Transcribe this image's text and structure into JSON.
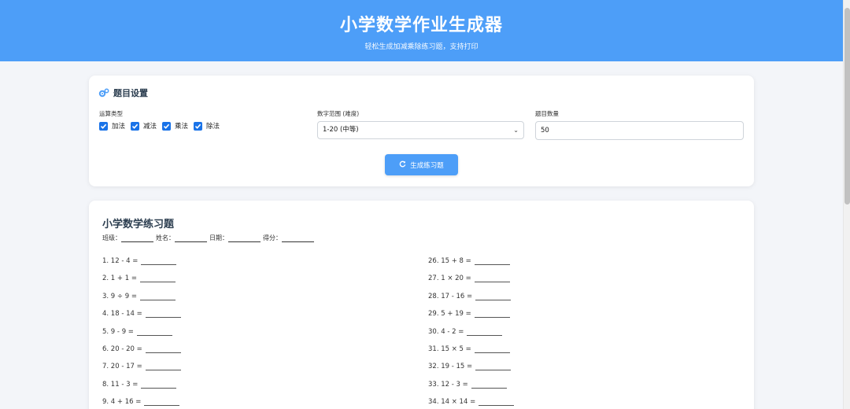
{
  "header": {
    "title": "小学数学作业生成器",
    "subtitle": "轻松生成加减乘除练习题，支持打印"
  },
  "settings": {
    "title": "题目设置",
    "op_label": "运算类型",
    "ops": [
      "加法",
      "减法",
      "乘法",
      "除法"
    ],
    "range_label": "数字范围 (难度)",
    "range_value": "1-20 (中等)",
    "count_label": "题目数量",
    "count_value": "50",
    "generate_label": "生成练习题"
  },
  "worksheet": {
    "title": "小学数学练习题",
    "fields": [
      "班级：",
      "姓名：",
      "日期：",
      "得分："
    ],
    "left": [
      "1. 12 - 4 =",
      "2. 1 + 1 =",
      "3. 9 ÷ 9 =",
      "4. 18 - 14 =",
      "5. 9 - 9 =",
      "6. 20 - 20 =",
      "7. 20 - 17 =",
      "8. 11 - 3 =",
      "9. 4 + 16 ="
    ],
    "right": [
      "26. 15 + 8 =",
      "27. 1 × 20 =",
      "28. 17 - 16 =",
      "29. 5 + 19 =",
      "30. 4 - 2 =",
      "31. 15 × 5 =",
      "32. 19 - 15 =",
      "33. 12 - 3 =",
      "34. 14 × 14 ="
    ]
  },
  "colors": {
    "header": "#4d9ef8",
    "checkbox": "#1a73e8",
    "button": "#4d9ef8"
  }
}
